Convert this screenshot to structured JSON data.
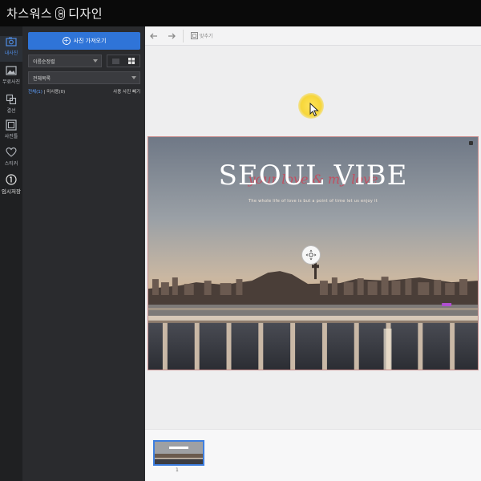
{
  "app": {
    "title_part1": "차스워스",
    "title_part2": "디자인"
  },
  "leftnav": {
    "items": [
      {
        "label": "내사진",
        "icon": "photo-icon",
        "active": true
      },
      {
        "label": "무료사진",
        "icon": "stock-photo-icon",
        "active": false
      },
      {
        "label": "결선",
        "icon": "layers-icon",
        "active": false
      },
      {
        "label": "사진틀",
        "icon": "frame-icon",
        "active": false
      },
      {
        "label": "스티커",
        "icon": "heart-icon",
        "active": false
      },
      {
        "label": "임시저장",
        "icon": "save-icon",
        "active": false
      }
    ]
  },
  "sidepanel": {
    "import_button": "사진 가져오기",
    "sort_select": "이름순정렬",
    "folder_select": "전체목록",
    "link_all": "전체(1)",
    "link_unused": "미사용(0)",
    "link_hide_used": "사용 사진 빼기"
  },
  "toolbar": {
    "undo_icon": "undo-icon",
    "redo_icon": "redo-icon",
    "fit_label": "맞추기"
  },
  "canvas": {
    "title": "SEOUL VIBE",
    "script_text": "your love & my love",
    "subtitle": "The whole life of love is but a point of time let us enjoy it"
  },
  "pages": {
    "thumb_number": "1"
  },
  "colors": {
    "accent": "#2f74d8",
    "panel_bg": "#2a2b2e",
    "rail_bg": "#1f2022",
    "canvas_bg": "#eeeeef"
  }
}
